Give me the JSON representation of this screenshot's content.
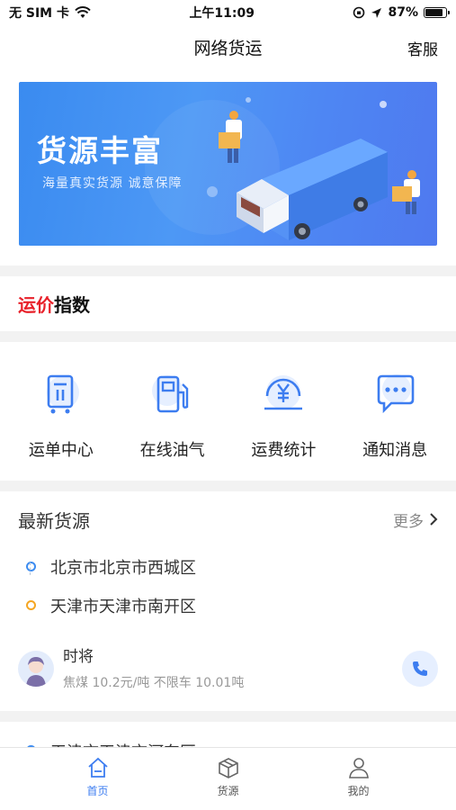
{
  "status": {
    "carrier": "无 SIM 卡",
    "time": "上午11:09",
    "battery": "87%",
    "battery_level": 0.87
  },
  "nav": {
    "title": "网络货运",
    "right": "客服"
  },
  "banner": {
    "title": "货源丰富",
    "subtitle": "海量真实货源 诚意保障"
  },
  "index": {
    "red": "运价",
    "black": "指数"
  },
  "menu": [
    {
      "label": "运单中心",
      "icon": "waybill-icon"
    },
    {
      "label": "在线油气",
      "icon": "fuel-icon"
    },
    {
      "label": "运费统计",
      "icon": "yuan-coin-icon"
    },
    {
      "label": "通知消息",
      "icon": "message-icon"
    }
  ],
  "latest": {
    "title": "最新货源",
    "more": "更多",
    "from": "北京市北京市西城区",
    "to": "天津市天津市南开区",
    "shipper": "时将",
    "info": "焦煤 10.2元/吨 不限车 10.01吨"
  },
  "second": {
    "from": "天津市天津市河东区"
  },
  "tabs": [
    {
      "label": "首页",
      "icon": "home-icon",
      "active": true
    },
    {
      "label": "货源",
      "icon": "box-icon",
      "active": false
    },
    {
      "label": "我的",
      "icon": "user-icon",
      "active": false
    }
  ],
  "colors": {
    "accent": "#3d7df0",
    "red": "#e8222b",
    "orange": "#f5a623"
  }
}
